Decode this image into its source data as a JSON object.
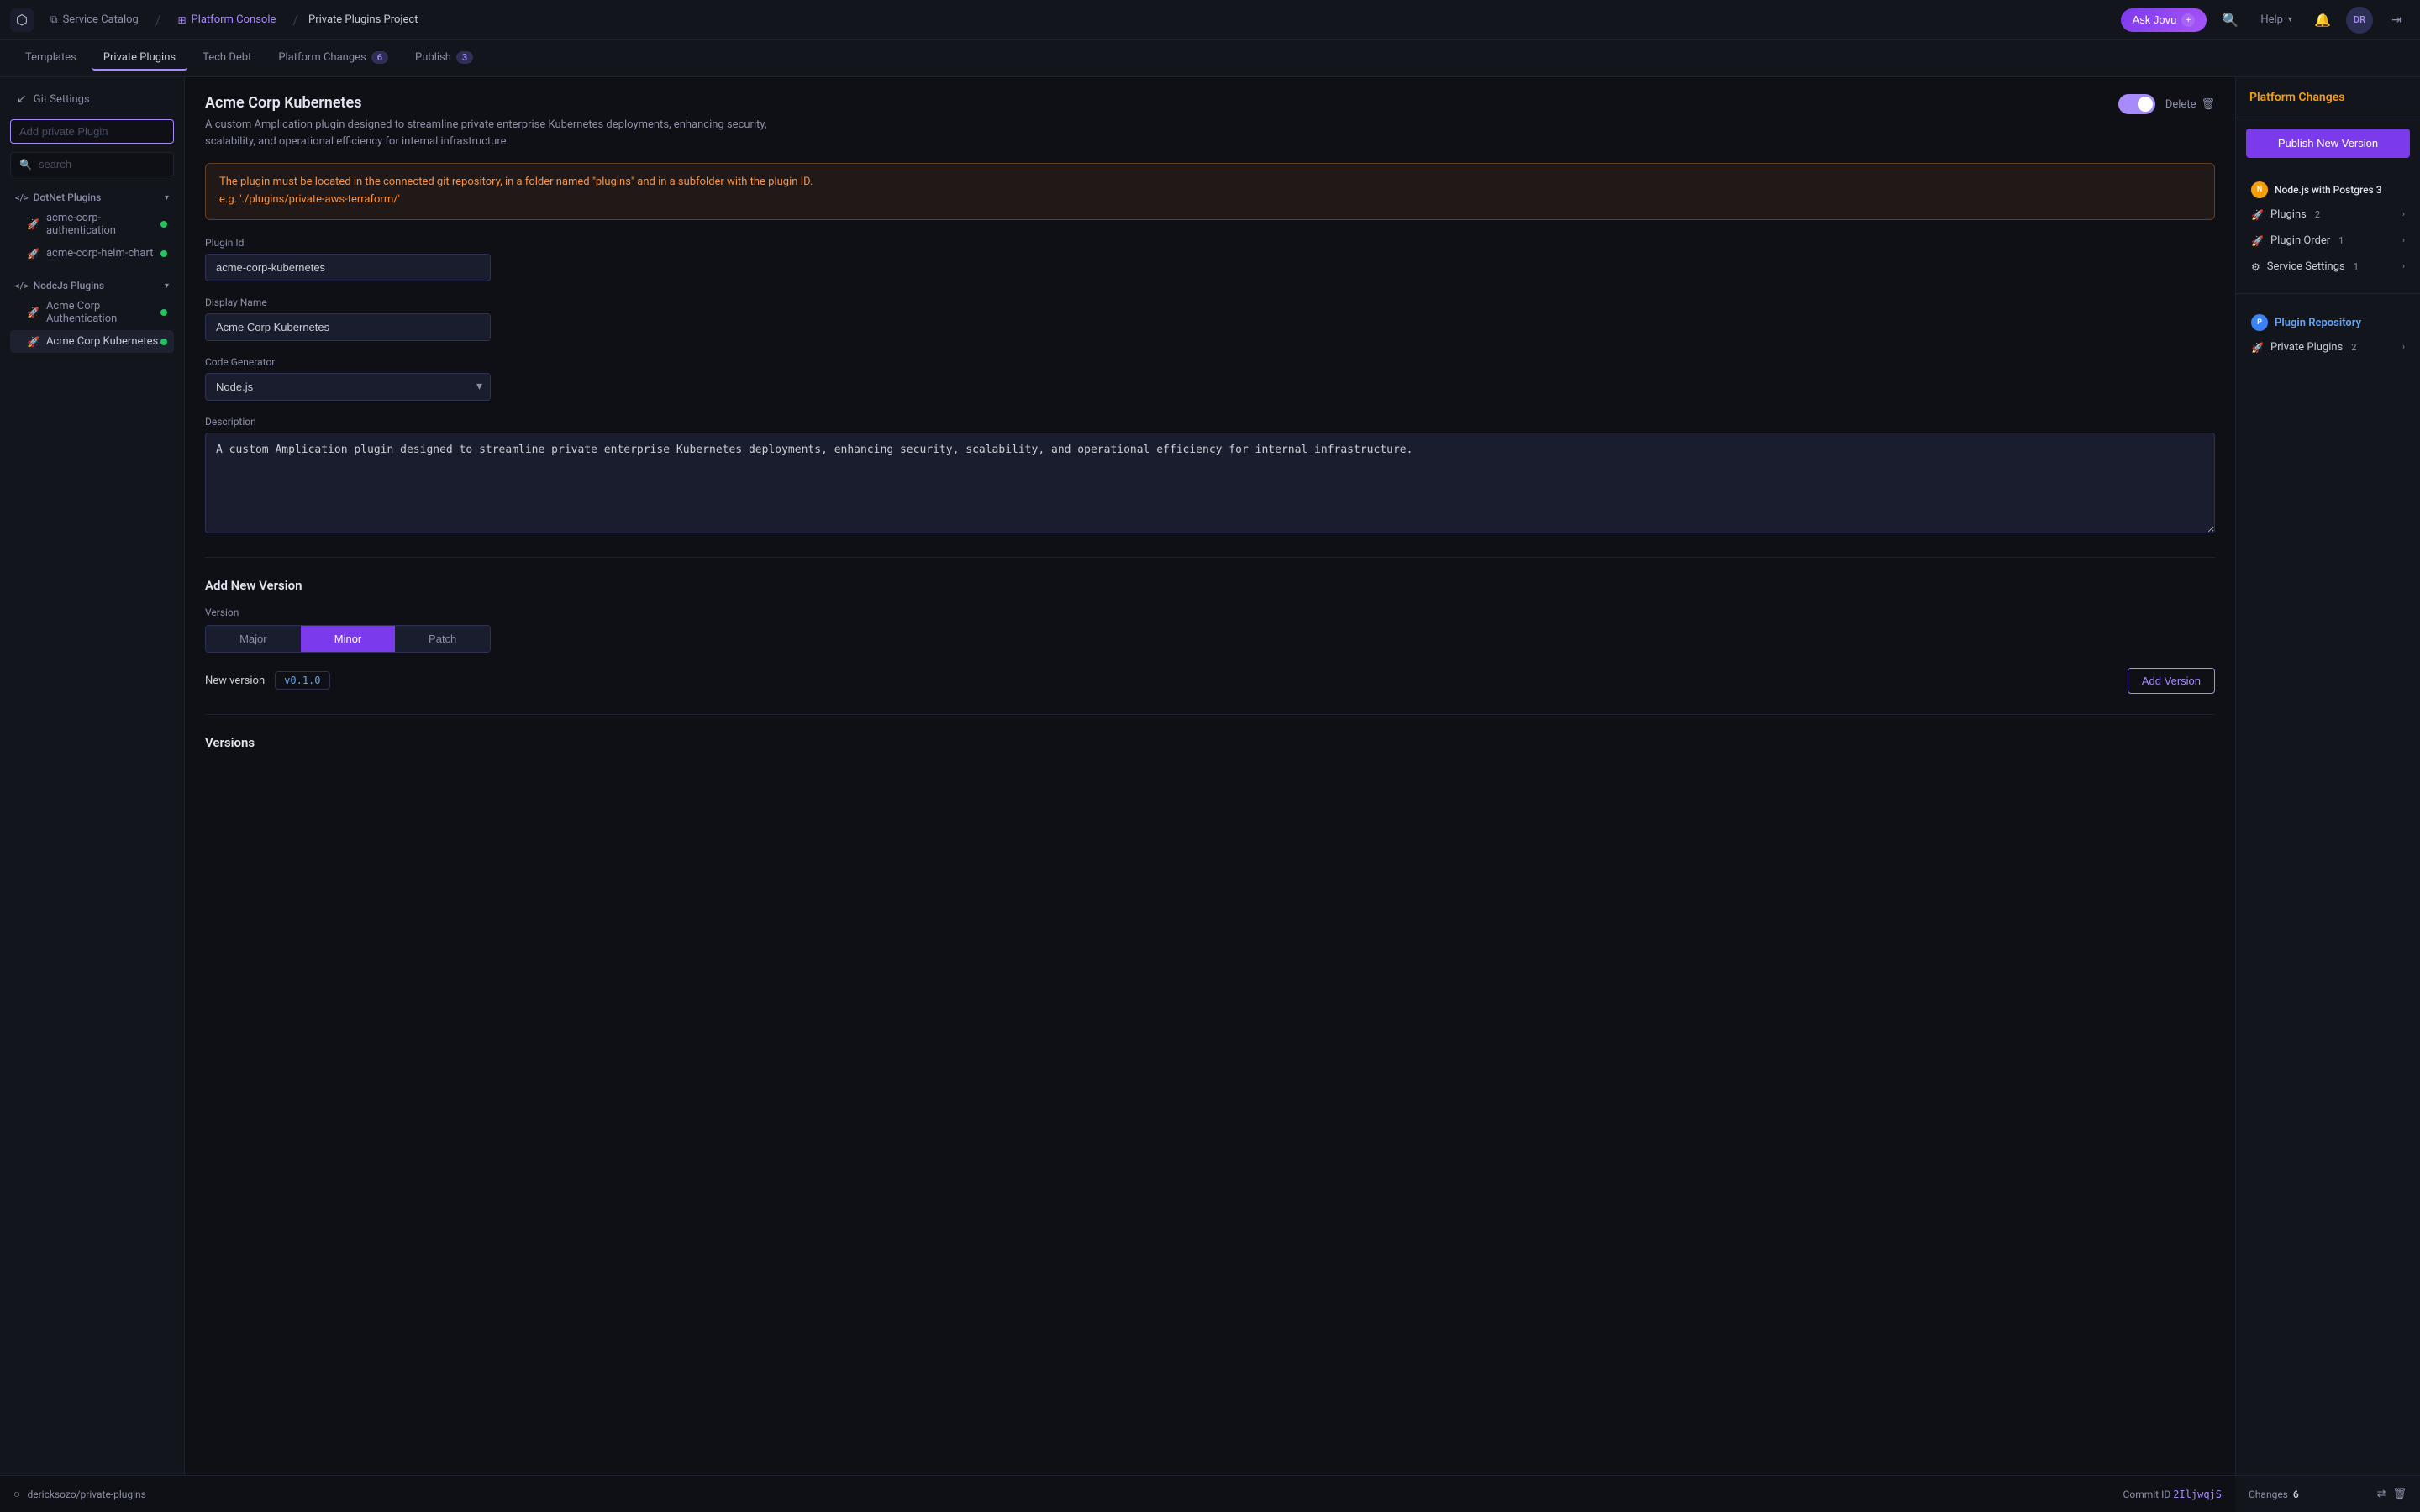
{
  "topNav": {
    "logo": "⬡",
    "serviceCatalog": "Service Catalog",
    "platformConsole": "Platform Console",
    "projectName": "Private Plugins Project",
    "askJovu": "Ask Jovu",
    "askJovuIcon": "+",
    "searchIcon": "🔍",
    "helpLabel": "Help",
    "notificationIcon": "🔔",
    "userInitials": "DR",
    "signoutIcon": "→"
  },
  "tabs": [
    {
      "id": "templates",
      "label": "Templates",
      "badge": null
    },
    {
      "id": "private-plugins",
      "label": "Private Plugins",
      "badge": null,
      "active": true
    },
    {
      "id": "tech-debt",
      "label": "Tech Debt",
      "badge": null
    },
    {
      "id": "platform-changes",
      "label": "Platform Changes",
      "badge": "6"
    },
    {
      "id": "publish",
      "label": "Publish",
      "badge": "3"
    }
  ],
  "sidebar": {
    "gitSettings": "Git Settings",
    "addPluginPlaceholder": "Add private Plugin",
    "searchPlaceholder": "search",
    "groups": [
      {
        "id": "dotnet",
        "title": "DotNet  Plugins",
        "icon": "</>",
        "expanded": true,
        "items": [
          {
            "id": "acme-corp-authentication",
            "label": "acme-corp-authentication",
            "active": false
          },
          {
            "id": "acme-corp-helm-chart",
            "label": "acme-corp-helm-chart",
            "active": false
          }
        ]
      },
      {
        "id": "nodejs",
        "title": "NodeJs  Plugins",
        "icon": "</>",
        "expanded": true,
        "items": [
          {
            "id": "acme-corp-authentication-node",
            "label": "Acme Corp Authentication",
            "active": false
          },
          {
            "id": "acme-corp-kubernetes",
            "label": "Acme Corp Kubernetes",
            "active": true
          }
        ]
      }
    ]
  },
  "pluginDetail": {
    "title": "Acme Corp Kubernetes",
    "description": "A custom Amplication plugin designed to streamline private enterprise Kubernetes deployments, enhancing security, scalability, and operational efficiency for internal infrastructure.",
    "warning": "The plugin must be located in the connected git repository, in a folder named \"plugins\" and in a subfolder with the plugin ID.\ne.g. './plugins/private-aws-terraform/'",
    "pluginIdLabel": "Plugin Id",
    "pluginIdValue": "acme-corp-kubernetes",
    "displayNameLabel": "Display Name",
    "displayNameValue": "Acme Corp Kubernetes",
    "codeGeneratorLabel": "Code Generator",
    "codeGeneratorValue": "Node.js",
    "descriptionLabel": "Description",
    "descriptionValue": "A custom Amplication plugin designed to streamline private enterprise Kubernetes deployments, enhancing security, scalability, and operational efficiency for internal infrastructure.",
    "addNewVersionTitle": "Add New Version",
    "versionLabel": "Version",
    "versionOptions": [
      "Major",
      "Minor",
      "Patch"
    ],
    "activeVersion": "Minor",
    "newVersionLabel": "New version",
    "newVersionValue": "v0.1.0",
    "addVersionBtn": "Add Version",
    "versionsSectionTitle": "Versions"
  },
  "rightPanel": {
    "title": "Platform Changes",
    "publishBtn": "Publish New Version",
    "sections": [
      {
        "id": "nodejs-postgres",
        "icon": "circle-orange",
        "label": "Node.js with Postgres 3",
        "isHeader": true
      },
      {
        "id": "plugins",
        "icon": "rocket",
        "label": "Plugins",
        "badge": "2",
        "hasChevron": true
      },
      {
        "id": "plugin-order",
        "icon": "rocket",
        "label": "Plugin Order",
        "badge": "1",
        "hasChevron": true
      },
      {
        "id": "service-settings",
        "icon": "gear",
        "label": "Service Settings",
        "badge": "1",
        "hasChevron": true
      }
    ],
    "pluginRepo": {
      "id": "plugin-repository",
      "icon": "circle-blue",
      "label": "Plugin Repository",
      "isHeader": true
    },
    "repoItems": [
      {
        "id": "private-plugins",
        "icon": "rocket",
        "label": "Private Plugins",
        "badge": "2",
        "hasChevron": true
      }
    ],
    "changesLabel": "Changes",
    "changesCount": "6"
  },
  "footer": {
    "gitUser": "dericksozo/private-plugins",
    "commitLabel": "Commit ID",
    "commitValue": "2IljwqjS"
  }
}
